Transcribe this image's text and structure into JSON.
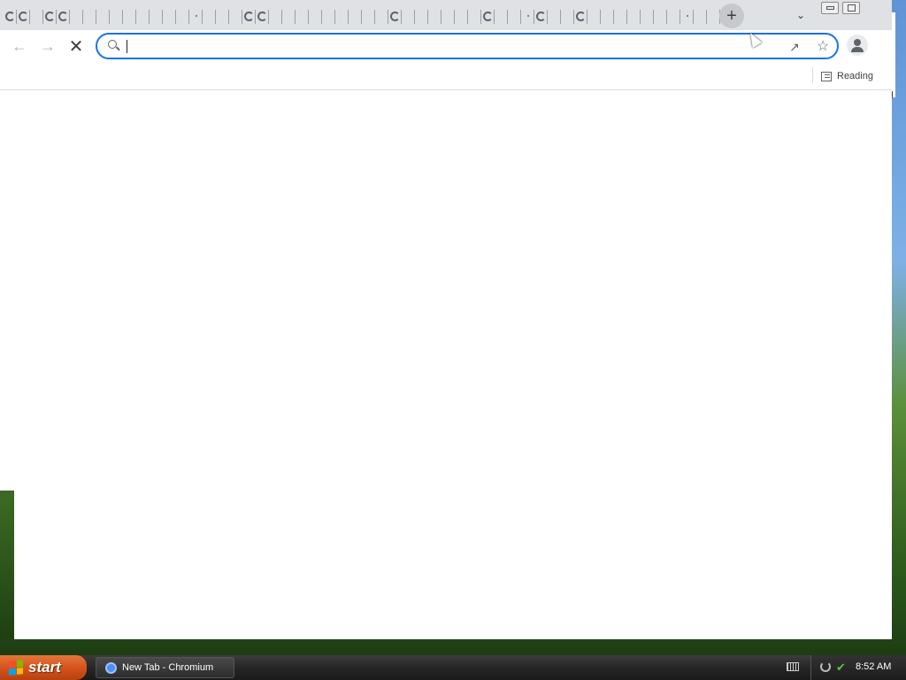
{
  "browser": {
    "tabs_count_visible": 54,
    "omnibox": {
      "value": "",
      "placeholder": ""
    },
    "bookmarks": {
      "reading_list_label": "Reading list"
    },
    "ghost_window_text": "ding"
  },
  "taskbar": {
    "start_label": "start",
    "task_items": [
      {
        "label": "New Tab - Chromium"
      }
    ],
    "clock": "8:52 AM"
  },
  "colors": {
    "accent": "#1a73e8",
    "tabstrip": "#dfe1e5",
    "start": "#d4541e"
  }
}
